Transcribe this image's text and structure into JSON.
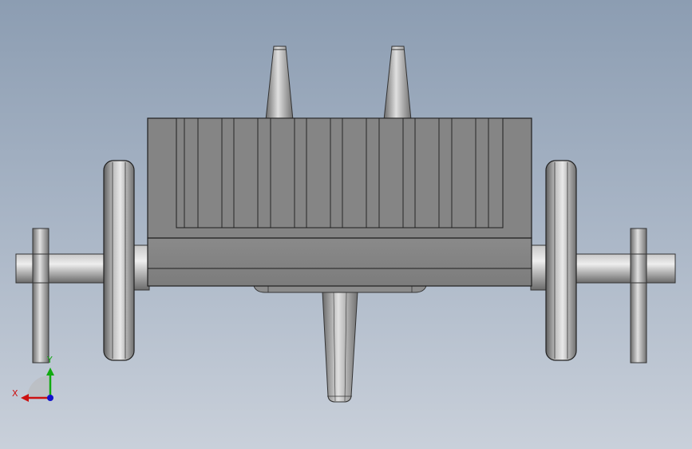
{
  "viewport": {
    "view": "front",
    "background_top": "#8c9db2",
    "background_bottom": "#c9d0da"
  },
  "model": {
    "body_color": "#858585",
    "edge_color": "#1e1e1e",
    "highlight_color": "#e6e6e6",
    "rib_count": 17,
    "parts": [
      "body",
      "cooling-fins",
      "base",
      "left-wheel",
      "right-wheel",
      "axle",
      "left-handle",
      "right-handle",
      "front-cones",
      "rear-leg"
    ]
  },
  "triad": {
    "x_label": "X",
    "y_label": "Y",
    "x_color": "#cc1111",
    "y_color": "#11aa11",
    "z_color": "#1111cc"
  }
}
